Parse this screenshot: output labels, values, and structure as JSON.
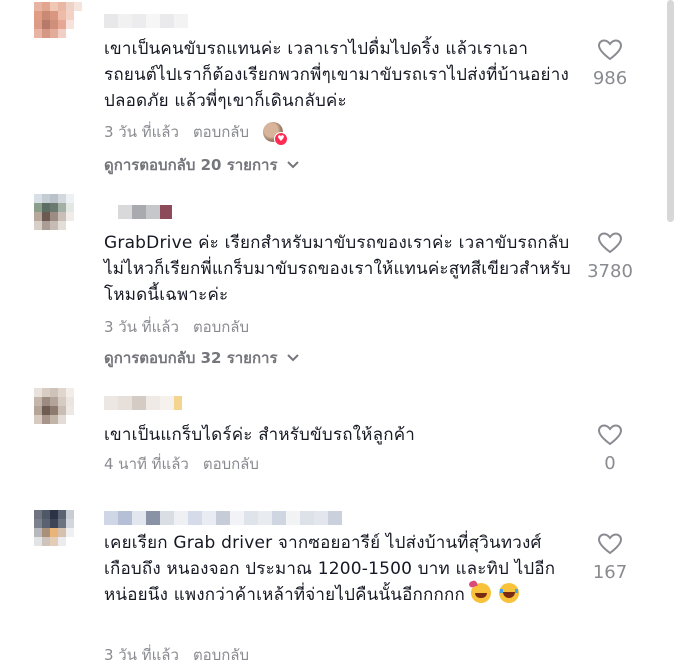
{
  "comments": [
    {
      "text": "เขาเป็นคนขับรถแทนค่ะ เวลาเราไปดื่มไปดริ้ง แล้วเราเอารถยนต์ไปเราก็ต้องเรียกพวกพี่ๆเขามาขับรถเราไปส่งที่บ้านอย่างปลอดภัย แล้วพี่ๆเขาก็เดินกลับค่ะ",
      "time": "3 วัน ที่แล้ว",
      "reply_label": "ตอบกลับ",
      "likes": "986",
      "view_replies": "ดูการตอบกลับ 20 รายการ"
    },
    {
      "text": "GrabDrive ค่ะ เรียกสำหรับมาขับรถของเราค่ะ เวลาขับรถกลับไม่ไหวก็เรียกพี่แกร็บมาขับรถของเราให้แทนค่ะสูทสีเขียวสำหรับโหมดนี้เฉพาะค่ะ",
      "time": "3 วัน ที่แล้ว",
      "reply_label": "ตอบกลับ",
      "likes": "3780",
      "view_replies": "ดูการตอบกลับ 32 รายการ"
    },
    {
      "text": "เขาเป็นแกร็บไดร์ค่ะ สำหรับขับรถให้ลูกค้า",
      "time": "4 นาที ที่แล้ว",
      "reply_label": "ตอบกลับ",
      "likes": "0"
    },
    {
      "text": "เคยเรียก Grab driver จากซอยอารีย์ ไปส่งบ้านที่สุวินทวงศ์ เกือบถึง หนองจอก ประมาณ 1200-1500 บาท และทิป ไปอีกหน่อยนึง แพงกว่าค้าเหล้าที่จ่ายไปคืนนั้นอีกกกกก",
      "time": "3 วัน ที่แล้ว",
      "reply_label": "ตอบกลับ",
      "likes": "167"
    }
  ],
  "colors": {
    "text": "#161823",
    "meta": "#8a8b91",
    "liked_badge": "#fe2c55"
  }
}
